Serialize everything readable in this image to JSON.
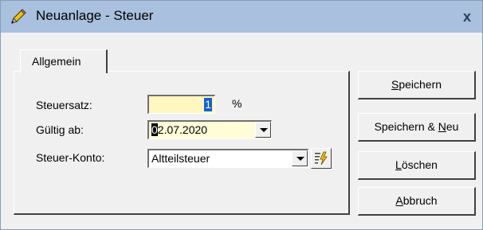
{
  "window": {
    "title": "Neuanlage - Steuer",
    "close_label": "x"
  },
  "tabs": [
    {
      "label": "Allgemein",
      "active": true
    }
  ],
  "form": {
    "rate": {
      "label": "Steuersatz:",
      "value": "1",
      "unit": "%"
    },
    "valid_from": {
      "label": "Gültig ab:",
      "cursor_char": "0",
      "rest": "2.07.2020"
    },
    "account": {
      "label": "Steuer-Konto:",
      "value": "Altteilsteuer"
    }
  },
  "buttons": {
    "save": {
      "mnemonic": "S",
      "rest": "peichern"
    },
    "save_new": {
      "before": "Speichern & ",
      "mnemonic": "N",
      "rest": "eu"
    },
    "delete": {
      "mnemonic": "L",
      "rest": "öschen"
    },
    "cancel": {
      "mnemonic": "A",
      "rest": "bbruch"
    }
  },
  "icons": {
    "title": "pencil-icon",
    "tool": "lightning-edit-icon",
    "dropdown": "chevron-down-icon"
  },
  "colors": {
    "titlebar": "#a9c0df",
    "selection": "#1560d6",
    "field_yellow": "#fff6c0"
  }
}
